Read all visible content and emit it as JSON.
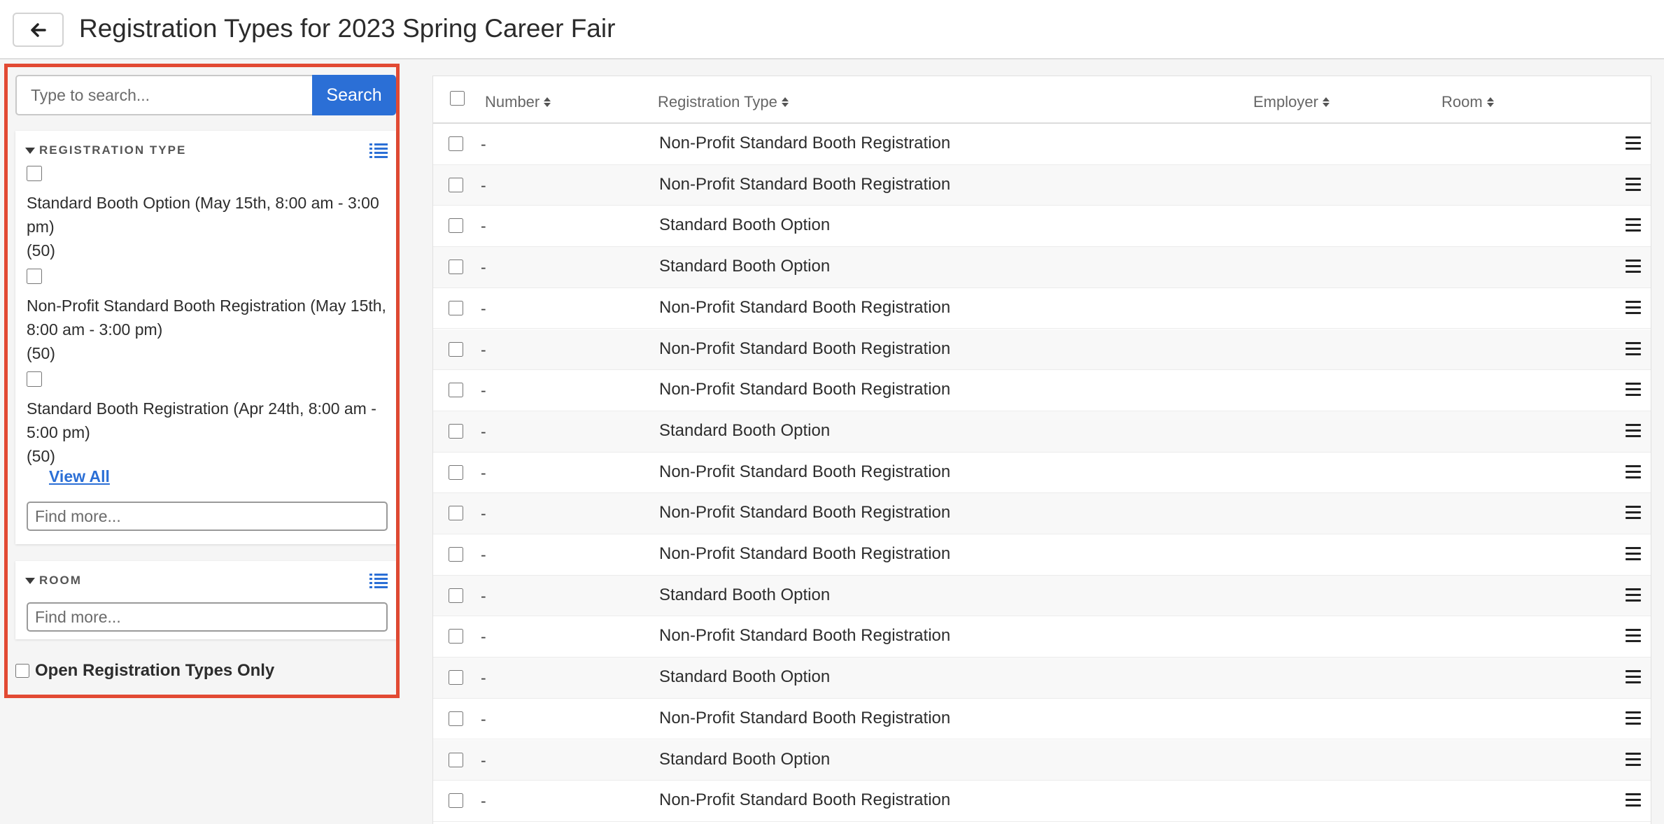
{
  "header": {
    "title": "Registration Types for 2023 Spring Career Fair"
  },
  "sidebar": {
    "search": {
      "placeholder": "Type to search...",
      "button_label": "Search"
    },
    "registration_type": {
      "title": "REGISTRATION TYPE",
      "options": [
        {
          "label": "Standard Booth Option (May 15th, 8:00 am - 3:00 pm)",
          "count": "(50)"
        },
        {
          "label": "Non-Profit Standard Booth Registration (May 15th, 8:00 am - 3:00 pm)",
          "count": "(50)"
        },
        {
          "label": "Standard Booth Registration (Apr 24th, 8:00 am - 5:00 pm)",
          "count": "(50)"
        }
      ],
      "view_all": "View All",
      "find_placeholder": "Find more..."
    },
    "room": {
      "title": "ROOM",
      "find_placeholder": "Find more..."
    },
    "open_only_label": "Open Registration Types Only"
  },
  "table": {
    "columns": {
      "number": "Number",
      "registration_type": "Registration Type",
      "employer": "Employer",
      "room": "Room"
    },
    "rows": [
      {
        "number": "-",
        "type": "Non-Profit Standard Booth Registration"
      },
      {
        "number": "-",
        "type": "Non-Profit Standard Booth Registration"
      },
      {
        "number": "-",
        "type": "Standard Booth Option"
      },
      {
        "number": "-",
        "type": "Standard Booth Option"
      },
      {
        "number": "-",
        "type": "Non-Profit Standard Booth Registration"
      },
      {
        "number": "-",
        "type": "Non-Profit Standard Booth Registration"
      },
      {
        "number": "-",
        "type": "Non-Profit Standard Booth Registration"
      },
      {
        "number": "-",
        "type": "Standard Booth Option"
      },
      {
        "number": "-",
        "type": "Non-Profit Standard Booth Registration"
      },
      {
        "number": "-",
        "type": "Non-Profit Standard Booth Registration"
      },
      {
        "number": "-",
        "type": "Non-Profit Standard Booth Registration"
      },
      {
        "number": "-",
        "type": "Standard Booth Option"
      },
      {
        "number": "-",
        "type": "Non-Profit Standard Booth Registration"
      },
      {
        "number": "-",
        "type": "Standard Booth Option"
      },
      {
        "number": "-",
        "type": "Non-Profit Standard Booth Registration"
      },
      {
        "number": "-",
        "type": "Standard Booth Option"
      },
      {
        "number": "-",
        "type": "Non-Profit Standard Booth Registration"
      }
    ]
  },
  "colors": {
    "accent": "#2b6fd6",
    "highlight_border": "#e24a33"
  },
  "icons": {
    "back": "arrow-left-icon",
    "list": "list-icon",
    "row_menu": "hamburger-icon"
  }
}
